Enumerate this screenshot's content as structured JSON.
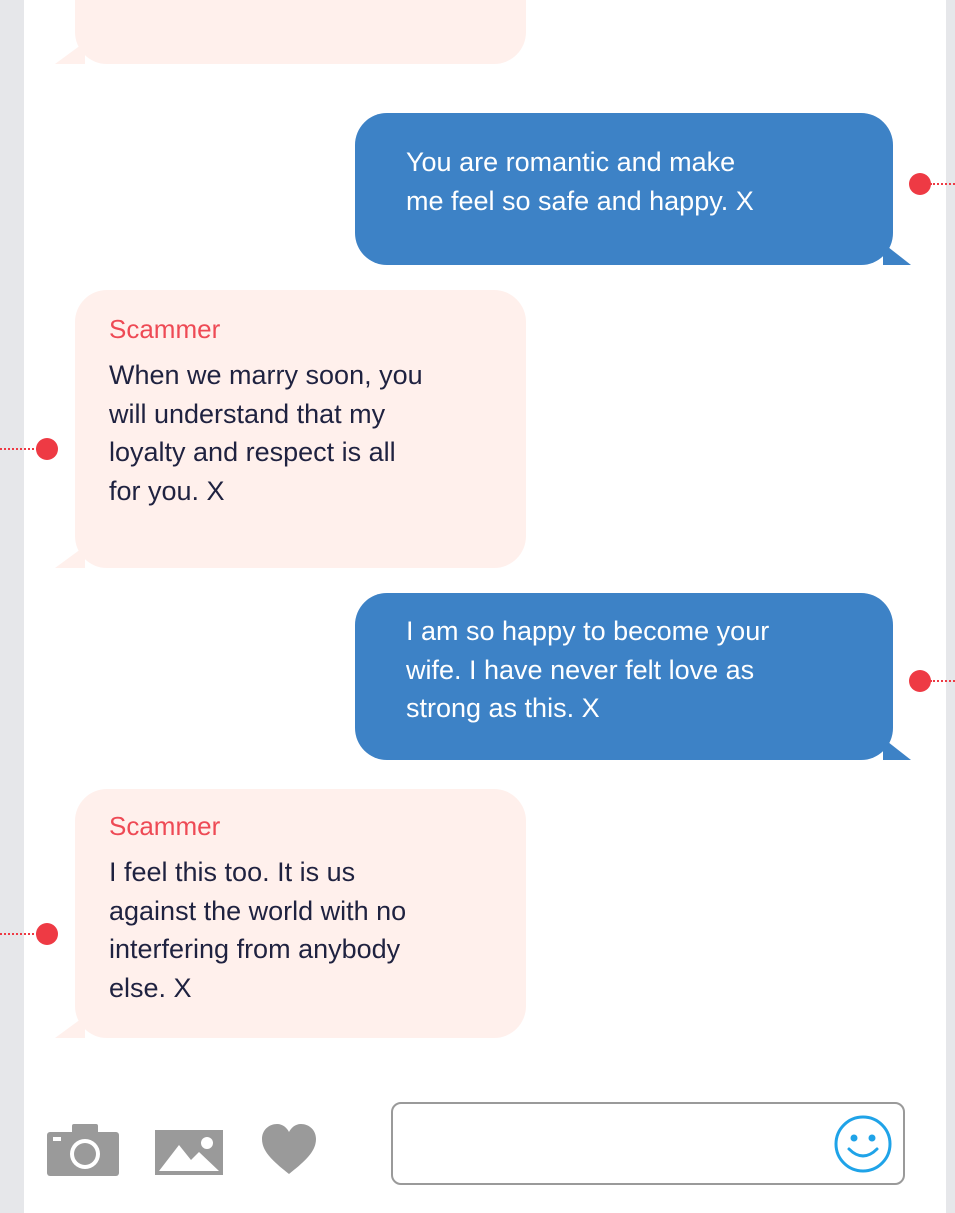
{
  "conversation": {
    "messages": [
      {
        "direction": "received",
        "sender": "",
        "text": ""
      },
      {
        "direction": "sent",
        "text": "You are romantic and make\nme feel so safe and happy. X"
      },
      {
        "direction": "received",
        "sender": "Scammer",
        "text": "When we marry soon, you\nwill understand that my\nloyalty and respect is all\nfor you. X"
      },
      {
        "direction": "sent",
        "text": "I am so happy to become your\nwife. I have never felt love as\nstrong as this. X"
      },
      {
        "direction": "received",
        "sender": "Scammer",
        "text": "I feel this too. It is us\nagainst the world with no\ninterfering from anybody\nelse. X"
      }
    ]
  },
  "composer": {
    "value": "",
    "placeholder": "",
    "icons": [
      "camera-icon",
      "image-icon",
      "heart-icon",
      "smiley-icon"
    ]
  },
  "colors": {
    "received_bubble": "#fff0ec",
    "sent_bubble": "#3d82c6",
    "sender_name": "#ee4a55",
    "annotation_marker": "#ee3a44",
    "icon_gray": "#9a9a9a",
    "emoji_blue": "#1fa3e8"
  }
}
